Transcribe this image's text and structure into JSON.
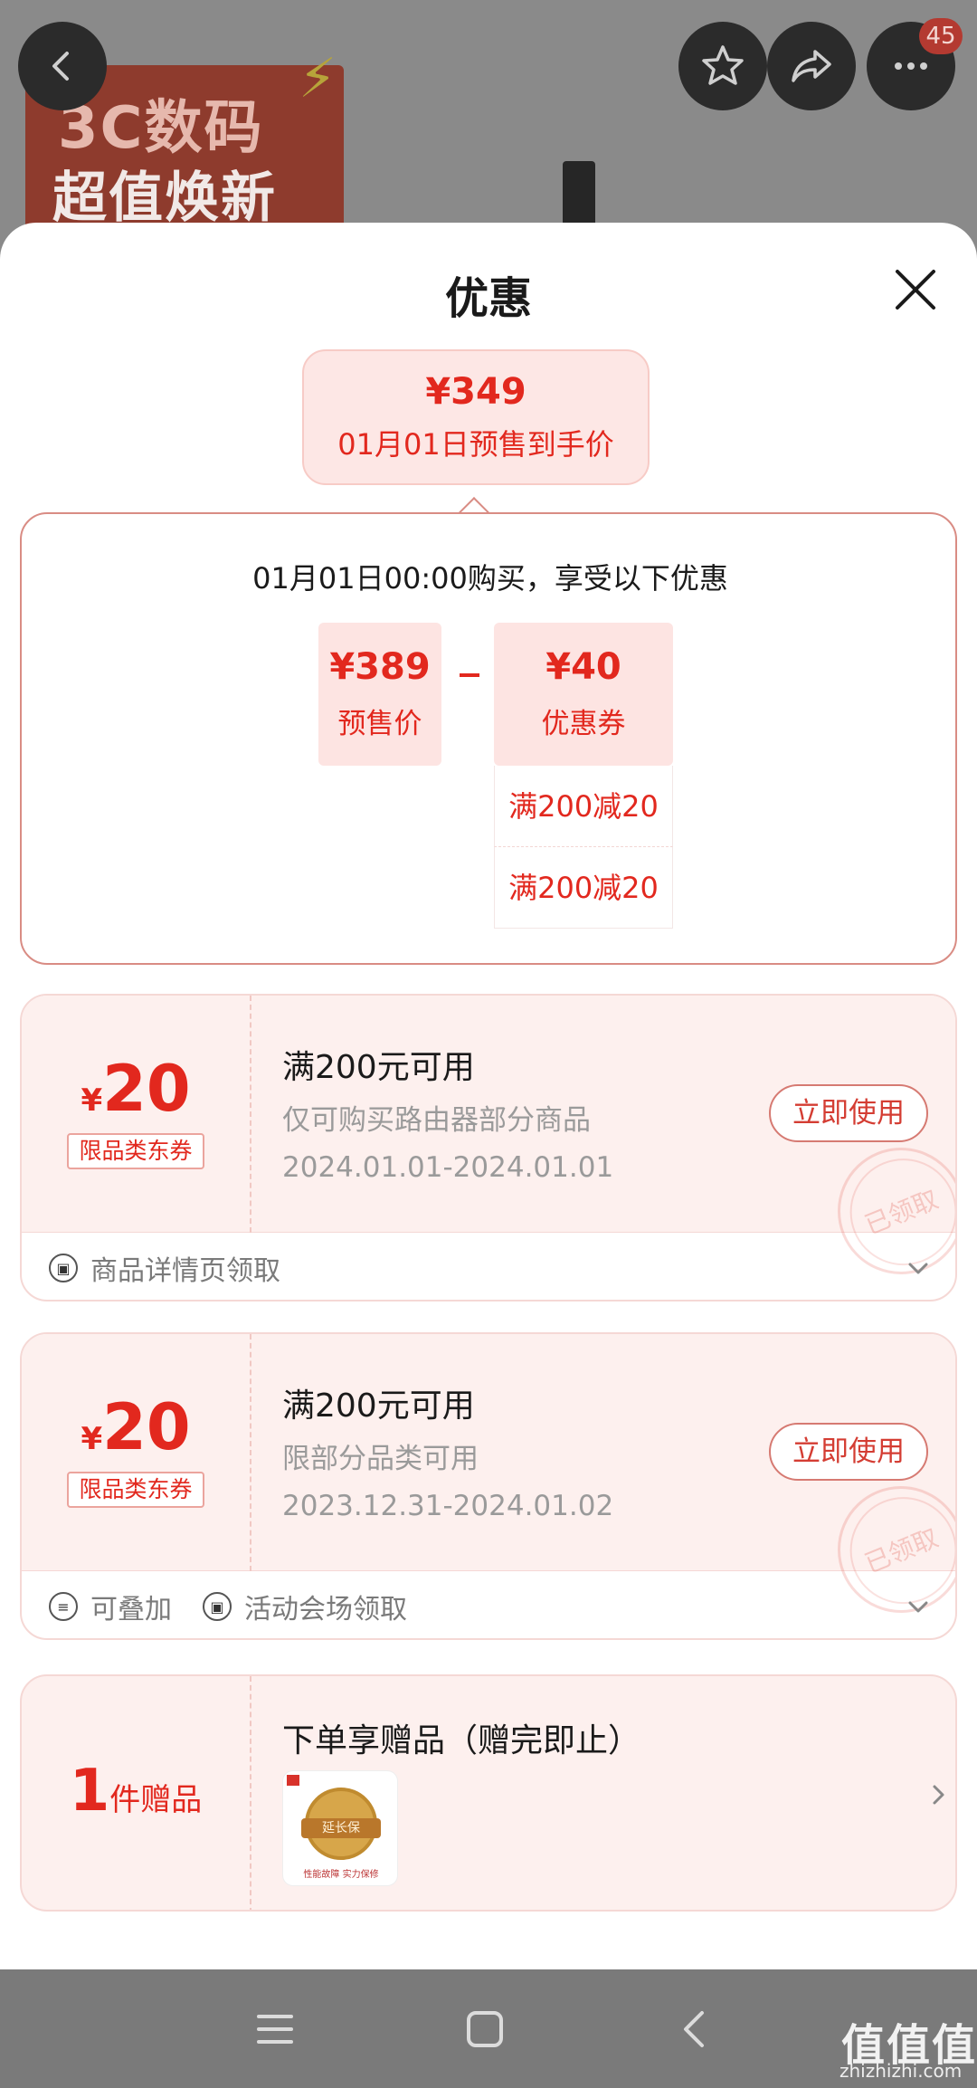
{
  "background": {
    "banner_line1": "3C数码",
    "banner_line2": "超值焕新",
    "cart_badge": "45"
  },
  "sheet": {
    "title": "优惠",
    "final_price": {
      "amount": "¥349",
      "label": "01月01日预售到手价"
    }
  },
  "calculation": {
    "headline": "01月01日00:00购买，享受以下优惠",
    "presale": {
      "amount": "¥389",
      "label": "预售价"
    },
    "discount": {
      "amount": "¥40",
      "label": "优惠券"
    },
    "discount_items": [
      "满200减20",
      "满200减20"
    ]
  },
  "coupons": [
    {
      "currency": "¥",
      "amount": "20",
      "tag": "限品类东券",
      "title": "满200元可用",
      "description": "仅可购买路由器部分商品",
      "validity": "2024.01.01-2024.01.01",
      "button": "立即使用",
      "stamp": "已领取",
      "footer": [
        {
          "icon": "ticket-icon",
          "label": "商品详情页领取"
        }
      ]
    },
    {
      "currency": "¥",
      "amount": "20",
      "tag": "限品类东券",
      "title": "满200元可用",
      "description": "限部分品类可用",
      "validity": "2023.12.31-2024.01.02",
      "button": "立即使用",
      "stamp": "已领取",
      "footer": [
        {
          "icon": "stack-icon",
          "label": "可叠加"
        },
        {
          "icon": "ticket-icon",
          "label": "活动会场领取"
        }
      ]
    }
  ],
  "gift": {
    "count": "1",
    "unit": "件赠品",
    "title": "下单享赠品（赠完即止）",
    "image_label": "延长保",
    "image_caption": "性能故障 实力保修"
  },
  "watermark": {
    "text": "值值值",
    "url": "zhizhizhi.com"
  },
  "colors": {
    "accent": "#e2281e",
    "accent_bg": "#fde4e2",
    "card_bg": "#fdf0ee"
  }
}
